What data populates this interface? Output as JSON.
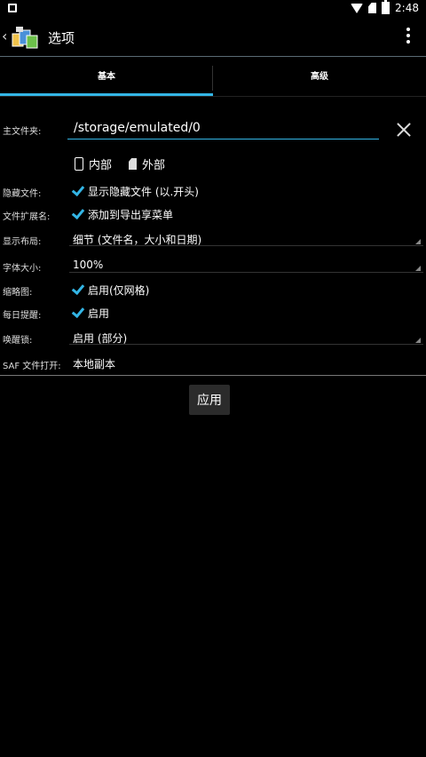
{
  "status": {
    "time": "2:48"
  },
  "appbar": {
    "title": "选项",
    "back_glyph": "‹"
  },
  "tabs": [
    {
      "label": "基本"
    },
    {
      "label": "高级"
    }
  ],
  "form": {
    "home_folder": {
      "label": "主文件夹:",
      "value": "/storage/emulated/0"
    },
    "storage": {
      "internal": "内部",
      "external": "外部"
    },
    "hidden_files": {
      "label": "隐藏文件:",
      "option": "显示隐藏文件 (以.开头)",
      "checked": true
    },
    "file_ext": {
      "label": "文件扩展名:",
      "option": "添加到导出享菜单",
      "checked": true
    },
    "display_layout": {
      "label": "显示布局:",
      "value": "细节 (文件名，大小和日期)"
    },
    "font_size": {
      "label": "字体大小:",
      "value": "100%"
    },
    "thumbnails": {
      "label": "缩略图:",
      "option": "启用(仅网格)",
      "checked": true
    },
    "daily_reminder": {
      "label": "每日提醒:",
      "option": "启用",
      "checked": true
    },
    "wake_lock": {
      "label": "唤醒锁:",
      "value": "启用 (部分)"
    },
    "saf_open": {
      "label": "SAF 文件打开:",
      "value": "本地副本"
    }
  },
  "apply_label": "应用",
  "colors": {
    "accent": "#33b5e5",
    "background": "#000000"
  }
}
